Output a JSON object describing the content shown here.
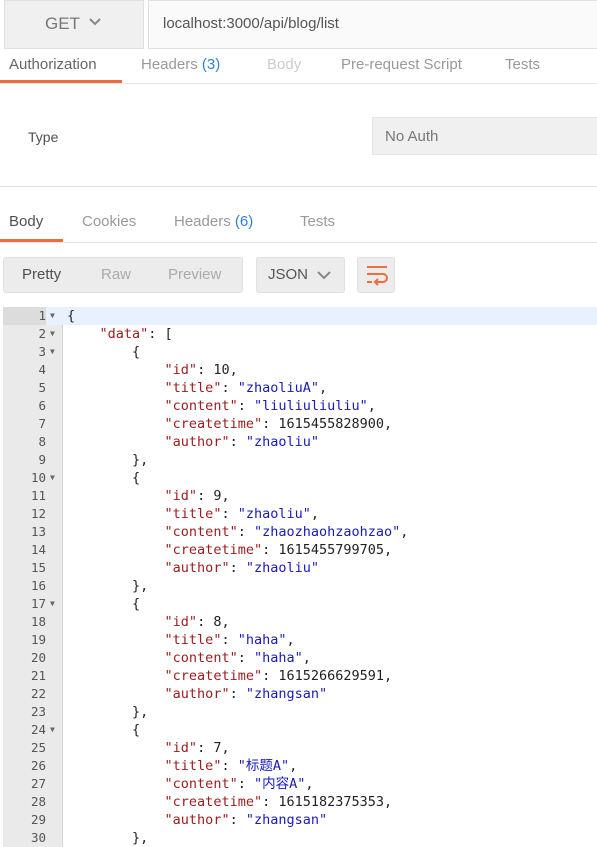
{
  "request": {
    "method": "GET",
    "url": "localhost:3000/api/blog/list",
    "tabs": [
      {
        "label": "Authorization",
        "count": ""
      },
      {
        "label": "Headers",
        "count": "(3)"
      },
      {
        "label": "Body",
        "count": ""
      },
      {
        "label": "Pre-request Script",
        "count": ""
      },
      {
        "label": "Tests",
        "count": ""
      }
    ],
    "active_tab": "Authorization"
  },
  "auth": {
    "type_label": "Type",
    "type_value": "No Auth"
  },
  "response": {
    "tabs": [
      {
        "label": "Body",
        "count": ""
      },
      {
        "label": "Cookies",
        "count": ""
      },
      {
        "label": "Headers",
        "count": "(6)"
      },
      {
        "label": "Tests",
        "count": ""
      }
    ],
    "active_tab": "Body",
    "views": [
      "Pretty",
      "Raw",
      "Preview"
    ],
    "active_view": "Pretty",
    "format": "JSON"
  },
  "code": {
    "lines": [
      {
        "n": 1,
        "fold": true,
        "t": [
          [
            "p",
            "{"
          ]
        ]
      },
      {
        "n": 2,
        "fold": true,
        "t": [
          [
            "s",
            "    "
          ],
          [
            "k",
            "\"data\""
          ],
          [
            "p",
            ": ["
          ]
        ]
      },
      {
        "n": 3,
        "fold": true,
        "t": [
          [
            "s",
            "        "
          ],
          [
            "p",
            "{"
          ]
        ]
      },
      {
        "n": 4,
        "fold": false,
        "t": [
          [
            "s",
            "            "
          ],
          [
            "k",
            "\"id\""
          ],
          [
            "p",
            ": "
          ],
          [
            "n",
            "10"
          ],
          [
            "p",
            ","
          ]
        ]
      },
      {
        "n": 5,
        "fold": false,
        "t": [
          [
            "s",
            "            "
          ],
          [
            "k",
            "\"title\""
          ],
          [
            "p",
            ": "
          ],
          [
            "v",
            "\"zhaoliuA\""
          ],
          [
            "p",
            ","
          ]
        ]
      },
      {
        "n": 6,
        "fold": false,
        "t": [
          [
            "s",
            "            "
          ],
          [
            "k",
            "\"content\""
          ],
          [
            "p",
            ": "
          ],
          [
            "v",
            "\"liuliuliuliu\""
          ],
          [
            "p",
            ","
          ]
        ]
      },
      {
        "n": 7,
        "fold": false,
        "t": [
          [
            "s",
            "            "
          ],
          [
            "k",
            "\"createtime\""
          ],
          [
            "p",
            ": "
          ],
          [
            "n",
            "1615455828900"
          ],
          [
            "p",
            ","
          ]
        ]
      },
      {
        "n": 8,
        "fold": false,
        "t": [
          [
            "s",
            "            "
          ],
          [
            "k",
            "\"author\""
          ],
          [
            "p",
            ": "
          ],
          [
            "v",
            "\"zhaoliu\""
          ]
        ]
      },
      {
        "n": 9,
        "fold": false,
        "t": [
          [
            "s",
            "        "
          ],
          [
            "p",
            "},"
          ]
        ]
      },
      {
        "n": 10,
        "fold": true,
        "t": [
          [
            "s",
            "        "
          ],
          [
            "p",
            "{"
          ]
        ]
      },
      {
        "n": 11,
        "fold": false,
        "t": [
          [
            "s",
            "            "
          ],
          [
            "k",
            "\"id\""
          ],
          [
            "p",
            ": "
          ],
          [
            "n",
            "9"
          ],
          [
            "p",
            ","
          ]
        ]
      },
      {
        "n": 12,
        "fold": false,
        "t": [
          [
            "s",
            "            "
          ],
          [
            "k",
            "\"title\""
          ],
          [
            "p",
            ": "
          ],
          [
            "v",
            "\"zhaoliu\""
          ],
          [
            "p",
            ","
          ]
        ]
      },
      {
        "n": 13,
        "fold": false,
        "t": [
          [
            "s",
            "            "
          ],
          [
            "k",
            "\"content\""
          ],
          [
            "p",
            ": "
          ],
          [
            "v",
            "\"zhaozhaohzaohzao\""
          ],
          [
            "p",
            ","
          ]
        ]
      },
      {
        "n": 14,
        "fold": false,
        "t": [
          [
            "s",
            "            "
          ],
          [
            "k",
            "\"createtime\""
          ],
          [
            "p",
            ": "
          ],
          [
            "n",
            "1615455799705"
          ],
          [
            "p",
            ","
          ]
        ]
      },
      {
        "n": 15,
        "fold": false,
        "t": [
          [
            "s",
            "            "
          ],
          [
            "k",
            "\"author\""
          ],
          [
            "p",
            ": "
          ],
          [
            "v",
            "\"zhaoliu\""
          ]
        ]
      },
      {
        "n": 16,
        "fold": false,
        "t": [
          [
            "s",
            "        "
          ],
          [
            "p",
            "},"
          ]
        ]
      },
      {
        "n": 17,
        "fold": true,
        "t": [
          [
            "s",
            "        "
          ],
          [
            "p",
            "{"
          ]
        ]
      },
      {
        "n": 18,
        "fold": false,
        "t": [
          [
            "s",
            "            "
          ],
          [
            "k",
            "\"id\""
          ],
          [
            "p",
            ": "
          ],
          [
            "n",
            "8"
          ],
          [
            "p",
            ","
          ]
        ]
      },
      {
        "n": 19,
        "fold": false,
        "t": [
          [
            "s",
            "            "
          ],
          [
            "k",
            "\"title\""
          ],
          [
            "p",
            ": "
          ],
          [
            "v",
            "\"haha\""
          ],
          [
            "p",
            ","
          ]
        ]
      },
      {
        "n": 20,
        "fold": false,
        "t": [
          [
            "s",
            "            "
          ],
          [
            "k",
            "\"content\""
          ],
          [
            "p",
            ": "
          ],
          [
            "v",
            "\"haha\""
          ],
          [
            "p",
            ","
          ]
        ]
      },
      {
        "n": 21,
        "fold": false,
        "t": [
          [
            "s",
            "            "
          ],
          [
            "k",
            "\"createtime\""
          ],
          [
            "p",
            ": "
          ],
          [
            "n",
            "1615266629591"
          ],
          [
            "p",
            ","
          ]
        ]
      },
      {
        "n": 22,
        "fold": false,
        "t": [
          [
            "s",
            "            "
          ],
          [
            "k",
            "\"author\""
          ],
          [
            "p",
            ": "
          ],
          [
            "v",
            "\"zhangsan\""
          ]
        ]
      },
      {
        "n": 23,
        "fold": false,
        "t": [
          [
            "s",
            "        "
          ],
          [
            "p",
            "},"
          ]
        ]
      },
      {
        "n": 24,
        "fold": true,
        "t": [
          [
            "s",
            "        "
          ],
          [
            "p",
            "{"
          ]
        ]
      },
      {
        "n": 25,
        "fold": false,
        "t": [
          [
            "s",
            "            "
          ],
          [
            "k",
            "\"id\""
          ],
          [
            "p",
            ": "
          ],
          [
            "n",
            "7"
          ],
          [
            "p",
            ","
          ]
        ]
      },
      {
        "n": 26,
        "fold": false,
        "t": [
          [
            "s",
            "            "
          ],
          [
            "k",
            "\"title\""
          ],
          [
            "p",
            ": "
          ],
          [
            "v",
            "\"标题A\""
          ],
          [
            "p",
            ","
          ]
        ]
      },
      {
        "n": 27,
        "fold": false,
        "t": [
          [
            "s",
            "            "
          ],
          [
            "k",
            "\"content\""
          ],
          [
            "p",
            ": "
          ],
          [
            "v",
            "\"内容A\""
          ],
          [
            "p",
            ","
          ]
        ]
      },
      {
        "n": 28,
        "fold": false,
        "t": [
          [
            "s",
            "            "
          ],
          [
            "k",
            "\"createtime\""
          ],
          [
            "p",
            ": "
          ],
          [
            "n",
            "1615182375353"
          ],
          [
            "p",
            ","
          ]
        ]
      },
      {
        "n": 29,
        "fold": false,
        "t": [
          [
            "s",
            "            "
          ],
          [
            "k",
            "\"author\""
          ],
          [
            "p",
            ": "
          ],
          [
            "v",
            "\"zhangsan\""
          ]
        ]
      },
      {
        "n": 30,
        "fold": false,
        "t": [
          [
            "s",
            "        "
          ],
          [
            "p",
            "},"
          ]
        ]
      }
    ]
  },
  "colors": {
    "accent": "#f26b3a",
    "count": "#2f7fd8",
    "json_key": "#9c1c1c",
    "json_string": "#1a1ab8"
  },
  "icons": [
    "chevron-down-icon",
    "wrap-lines-icon",
    "fold-arrow-icon"
  ]
}
